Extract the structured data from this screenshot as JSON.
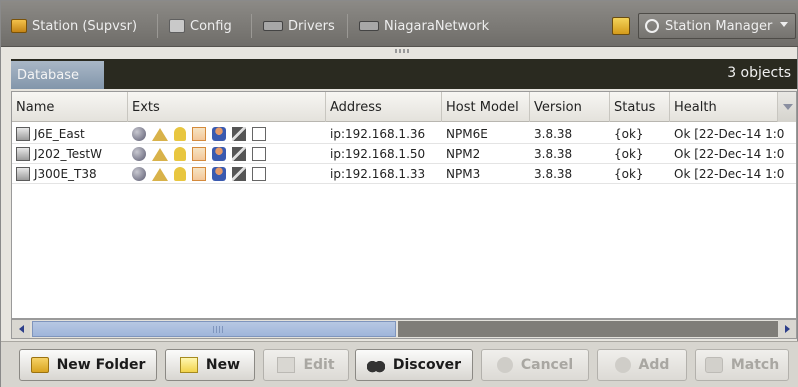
{
  "toolbar": {
    "crumbs": [
      {
        "label": "Station (Supvsr)"
      },
      {
        "label": "Config"
      },
      {
        "label": "Drivers"
      },
      {
        "label": "NiagaraNetwork"
      }
    ],
    "view_selector": "Station Manager"
  },
  "database": {
    "tab_label": "Database",
    "count_text": "3 objects"
  },
  "table": {
    "columns": [
      "Name",
      "Exts",
      "Address",
      "Host Model",
      "Version",
      "Status",
      "Health"
    ],
    "rows": [
      {
        "name": "J6E_East",
        "address": "ip:192.168.1.36",
        "host_model": "NPM6E",
        "version": "3.8.38",
        "status": "{ok}",
        "health": "Ok [22-Dec-14 1:0"
      },
      {
        "name": "J202_TestW",
        "address": "ip:192.168.1.50",
        "host_model": "NPM2",
        "version": "3.8.38",
        "status": "{ok}",
        "health": "Ok [22-Dec-14 1:0"
      },
      {
        "name": "J300E_T38",
        "address": "ip:192.168.1.33",
        "host_model": "NPM3",
        "version": "3.8.38",
        "status": "{ok}",
        "health": "Ok [22-Dec-14 1:0"
      }
    ]
  },
  "buttons": {
    "new_folder": "New Folder",
    "new": "New",
    "edit": "Edit",
    "discover": "Discover",
    "cancel": "Cancel",
    "add": "Add",
    "match": "Match"
  }
}
